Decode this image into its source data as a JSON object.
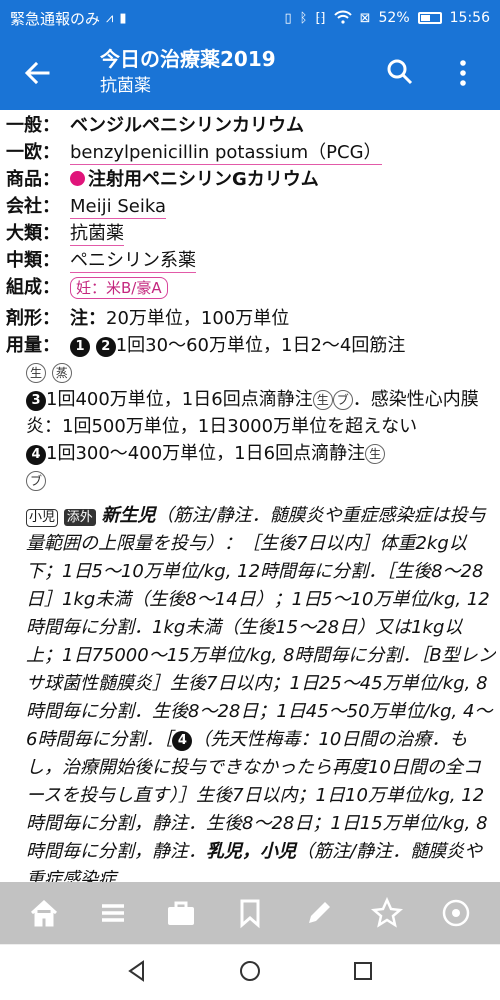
{
  "status_bar": {
    "left_text": "緊急通報のみ",
    "battery": "52%",
    "battery_level": 0.52,
    "time": "15:56"
  },
  "app_bar": {
    "title": "今日の治療薬2019",
    "subtitle": "抗菌薬"
  },
  "drug": {
    "general_label": "一般：",
    "general": "ベンジルペニシリンカリウム",
    "european_label": "一欧：",
    "european": "benzylpenicillin potassium（PCG）",
    "product_label": "商品：",
    "product": "注射用ペニシリンGカリウム",
    "company_label": "会社：",
    "company": "Meiji Seika",
    "major_label": "大類：",
    "major": "抗菌薬",
    "minor_label": "中類：",
    "minor": "ペニシリン系薬",
    "composition_label": "組成：",
    "pregnancy": "妊：米B/豪A",
    "form_label": "剤形：",
    "form_injection": "注：",
    "form_value": "20万単位，100万単位",
    "dose_label": "用量：",
    "dose_n1": "1",
    "dose_n2": "2",
    "dose_line1": "1回30～60万単位，1日2～4回筋注",
    "sym_sei": "生",
    "sym_ju": "蒸",
    "sym_pu": "ブ",
    "dose_n3": "3",
    "dose3_a": "1回400万単位，1日6回点滴静注",
    "dose3_b": "．感染性心内膜炎：1回500万単位，1日3000万単位を超えない",
    "dose_n4": "4",
    "dose4": "1回300～400万単位，1日6回点滴静注"
  },
  "pediatric": {
    "tag_child": "小児",
    "tag_extra": "添外",
    "neonate": "新生児",
    "text1": "（筋注/静注．髄膜炎や重症感染症は投与量範囲の上限量を投与）：［生後7日以内］体重2kg以下；1日5～10万単位/kg, 12時間毎に分割．［生後8～28日］1kg未満（生後8～14日）；1日5～10万単位/kg, 12時間毎に分割．1kg未満（生後15～28日）又は1kg以上；1日75000～15万単位/kg, 8時間毎に分割．［B型レンサ球菌性髄膜炎］生後7日以内；1日25～45万単位/kg, 8時間毎に分割．生後8～28日；1日45～50万単位/kg, 4～6時間毎に分割．［",
    "n4": "4",
    "text2": "（先天性梅毒：10日間の治療．もし，治療開始後に投与できなかったら再度10日間の全コースを投与し直す）］生後7日以内；1日10万単位/kg, 12時間毎に分割，静注．生後8～28日；1日15万単位/kg, 8時間毎に分割，静注．",
    "infant_label": "乳児，小児",
    "text3": "（筋注/静注．髄膜炎や重症感染症"
  },
  "toolbar": {
    "items": [
      "home-icon",
      "list-icon",
      "briefcase-icon",
      "bookmark-icon",
      "pencil-icon",
      "star-icon",
      "settings-icon"
    ]
  },
  "navbar": {
    "items": [
      "back-triangle-icon",
      "home-circle-icon",
      "recents-square-icon"
    ]
  }
}
